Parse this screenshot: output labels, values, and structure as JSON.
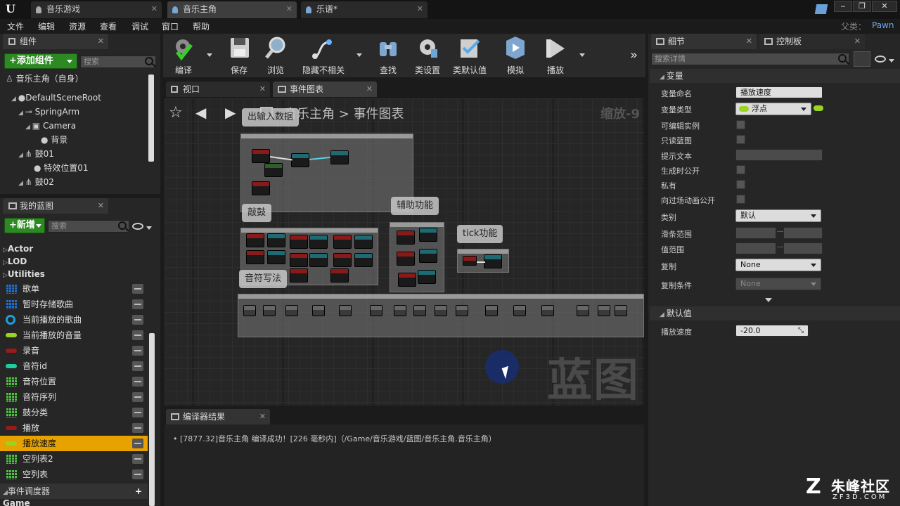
{
  "titlebar": {
    "tabs": [
      {
        "label": "音乐游戏"
      },
      {
        "label": "音乐主角"
      },
      {
        "label": "乐谱*"
      }
    ],
    "parent_label": "父类：",
    "parent_value": "Pawn"
  },
  "menu": [
    "文件",
    "编辑",
    "资源",
    "查看",
    "调试",
    "窗口",
    "帮助"
  ],
  "components": {
    "tab": "组件",
    "add_button": "+添加组件",
    "search_placeholder": "搜索",
    "root_item": "音乐主角（自身）",
    "tree": [
      {
        "label": "DefaultSceneRoot"
      },
      {
        "label": "SpringArm"
      },
      {
        "label": "Camera"
      },
      {
        "label": "背景"
      },
      {
        "label": "鼓01"
      },
      {
        "label": "特效位置01"
      },
      {
        "label": "鼓02"
      }
    ]
  },
  "my_blueprint": {
    "tab": "我的蓝图",
    "new_button": "+新增",
    "search_placeholder": "搜索",
    "categories": [
      "Actor",
      "LOD",
      "Utilities"
    ],
    "variables": [
      {
        "name": "歌单",
        "type": "grid-blue",
        "color": "#1e6fd0"
      },
      {
        "name": "暂时存储歌曲",
        "type": "grid-blue",
        "color": "#1e6fd0"
      },
      {
        "name": "当前播放的歌曲",
        "type": "ring",
        "color": "#1aa0e0"
      },
      {
        "name": "当前播放的音量",
        "type": "pill",
        "color": "#9ad420"
      },
      {
        "name": "录音",
        "type": "pill",
        "color": "#9a1a1a"
      },
      {
        "name": "音符id",
        "type": "pill",
        "color": "#1dcfa0"
      },
      {
        "name": "音符位置",
        "type": "grid-green",
        "color": "#4cc040"
      },
      {
        "name": "音符序列",
        "type": "grid-green",
        "color": "#4cc040"
      },
      {
        "name": "鼓分类",
        "type": "grid-green",
        "color": "#4cc040"
      },
      {
        "name": "播放",
        "type": "pill",
        "color": "#9a1a1a"
      },
      {
        "name": "播放速度",
        "type": "pill",
        "color": "#9ad420",
        "selected": true
      },
      {
        "name": "空列表2",
        "type": "grid-green",
        "color": "#4cc040"
      },
      {
        "name": "空列表",
        "type": "grid-green",
        "color": "#4cc040"
      }
    ],
    "dispatchers": "事件调度器",
    "bottom_partial": "Game"
  },
  "toolbar": {
    "compile": "编译",
    "save": "保存",
    "browse": "浏览",
    "hide": "隐藏不相关",
    "find": "查找",
    "class_settings": "类设置",
    "class_defaults": "类默认值",
    "simulate": "模拟",
    "play": "播放"
  },
  "editor_tabs": {
    "viewport": "视口",
    "event_graph": "事件图表"
  },
  "graph": {
    "breadcrumb_root": "音乐主角",
    "breadcrumb_sep": ">",
    "breadcrumb_current": "事件图表",
    "zoom": "缩放-9",
    "watermark": "蓝图",
    "comments": {
      "io": "出输入数据",
      "drum": "敲鼓",
      "helper": "辅助功能",
      "tick": "tick功能",
      "notes": "音符写法"
    }
  },
  "compiler": {
    "tab": "编译器结果",
    "message": "[7877.32]音乐主角 编译成功！[226 毫秒内]（/Game/音乐游戏/蓝图/音乐主角.音乐主角）"
  },
  "details": {
    "tab": "细节",
    "tab2": "控制板",
    "search_placeholder": "搜索详情",
    "section_var": "变量",
    "section_default": "默认值",
    "labels": {
      "var_name": "变量命名",
      "var_type": "变量类型",
      "editable": "可编辑实例",
      "readonly": "只读蓝图",
      "tooltip": "提示文本",
      "expose_spawn": "生成时公开",
      "private": "私有",
      "expose_cinematics": "向过场动画公开",
      "category": "类别",
      "slider_range": "滑条范围",
      "value_range": "值范围",
      "replication": "复制",
      "replication_condition": "复制条件",
      "default_play_speed": "播放速度"
    },
    "values": {
      "var_name": "播放速度",
      "var_type": "浮点",
      "category": "默认",
      "replication": "None",
      "replication_condition": "None",
      "default_play_speed": "-20.0",
      "range_sep": "..."
    }
  },
  "watermark_logo": {
    "cn": "朱峰社区",
    "url": "ZF3D.COM"
  }
}
